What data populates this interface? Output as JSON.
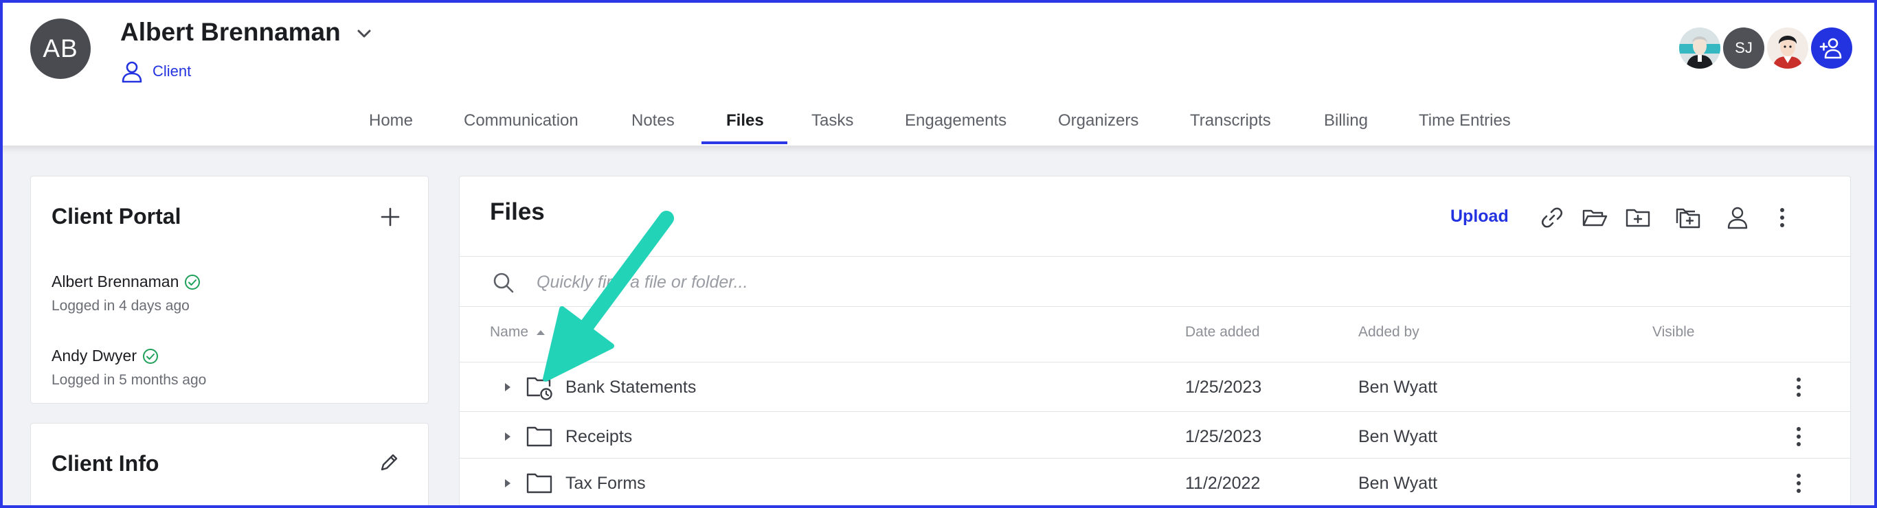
{
  "client": {
    "initials": "AB",
    "name": "Albert Brennaman",
    "role": "Client"
  },
  "nav": {
    "tabs": [
      {
        "label": "Home"
      },
      {
        "label": "Communication"
      },
      {
        "label": "Notes"
      },
      {
        "label": "Files",
        "active": true
      },
      {
        "label": "Tasks"
      },
      {
        "label": "Engagements"
      },
      {
        "label": "Organizers"
      },
      {
        "label": "Transcripts"
      },
      {
        "label": "Billing"
      },
      {
        "label": "Time Entries"
      }
    ]
  },
  "team": {
    "avatar2_initials": "SJ"
  },
  "portal": {
    "title": "Client Portal",
    "users": [
      {
        "name": "Albert Brennaman",
        "status": "Logged in 4 days ago"
      },
      {
        "name": "Andy Dwyer",
        "status": "Logged in 5 months ago"
      }
    ]
  },
  "info": {
    "title": "Client Info"
  },
  "files": {
    "title": "Files",
    "upload_label": "Upload",
    "search_placeholder": "Quickly find a file or folder...",
    "columns": {
      "name": "Name",
      "date": "Date added",
      "added_by": "Added by",
      "visible": "Visible"
    },
    "rows": [
      {
        "name": "Bank Statements",
        "date": "1/25/2023",
        "added_by": "Ben Wyatt",
        "icon": "folder-clock-icon"
      },
      {
        "name": "Receipts",
        "date": "1/25/2023",
        "added_by": "Ben Wyatt",
        "icon": "folder-icon"
      },
      {
        "name": "Tax Forms",
        "date": "11/2/2022",
        "added_by": "Ben Wyatt",
        "icon": "folder-icon"
      }
    ]
  },
  "colors": {
    "accent": "#2C38E6",
    "annotation_arrow": "#22D3B8"
  }
}
